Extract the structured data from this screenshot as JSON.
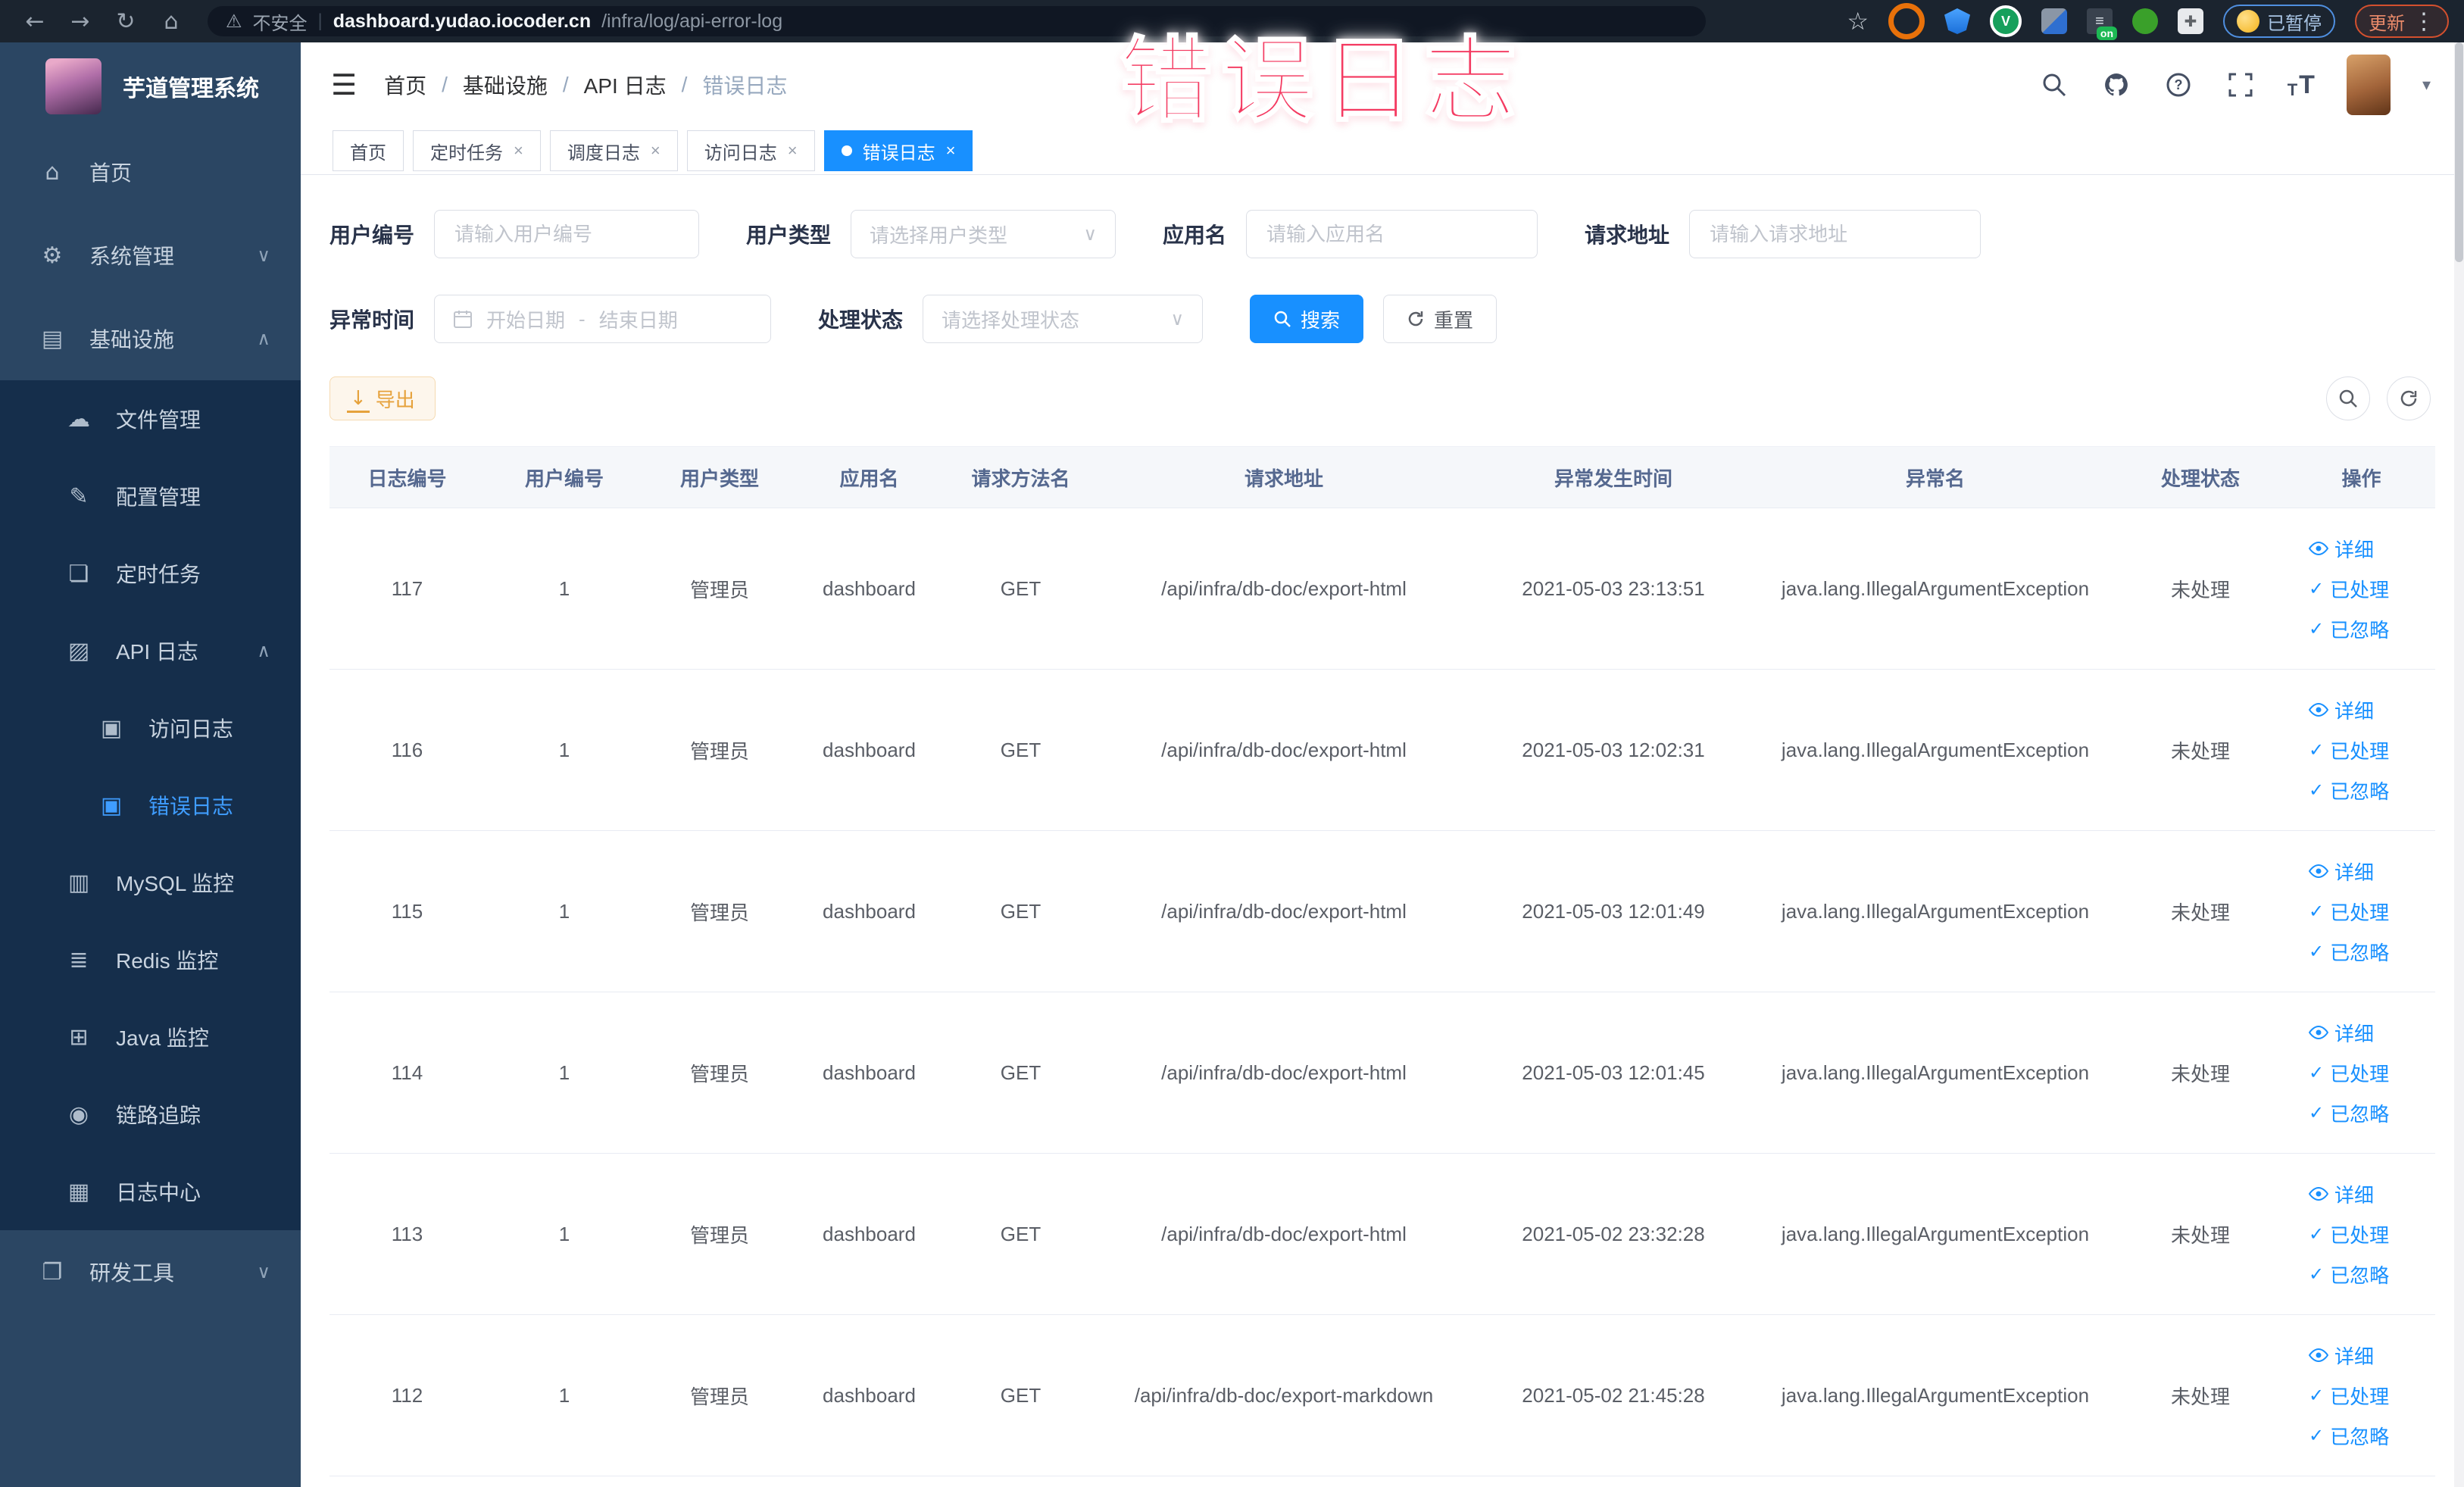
{
  "icons": {
    "back": "←",
    "forward": "→",
    "reload": "↻",
    "home_nav": "⌂",
    "warn": "⚠",
    "url_sep": "|",
    "star": "☆",
    "dots": "⋮",
    "hamburger": "☰",
    "caret": "▾",
    "close": "×",
    "chevron_down": "∨",
    "chevron_up": "∧",
    "home": "⌂",
    "gear": "⚙",
    "infra": "▤",
    "file": "☁",
    "config": "✎",
    "cron": "❏",
    "apilog": "▨",
    "doc": "▣",
    "mysql": "▥",
    "redis": "≣",
    "java": "⊞",
    "trace": "◉",
    "logcenter": "▦",
    "devtools": "❐",
    "check": "✓",
    "download": "↓",
    "breadcrumb_sep": "/",
    "ext_on": "on",
    "ext_v": "V",
    "ext_menu": "≡",
    "ext_puzzle": "✚",
    "help_q": "?"
  },
  "browser": {
    "security_label": "不安全",
    "url_host": "dashboard.yudao.iocoder.cn",
    "url_path": "/infra/log/api-error-log",
    "paused_pill": "已暂停",
    "update_pill": "更新"
  },
  "watermark": "错误日志",
  "sidebar": {
    "app_title": "芋道管理系统",
    "items": [
      {
        "label": "首页"
      },
      {
        "label": "系统管理"
      },
      {
        "label": "基础设施"
      },
      {
        "label": "文件管理"
      },
      {
        "label": "配置管理"
      },
      {
        "label": "定时任务"
      },
      {
        "label": "API 日志"
      },
      {
        "label": "访问日志"
      },
      {
        "label": "错误日志"
      },
      {
        "label": "MySQL 监控"
      },
      {
        "label": "Redis 监控"
      },
      {
        "label": "Java 监控"
      },
      {
        "label": "链路追踪"
      },
      {
        "label": "日志中心"
      },
      {
        "label": "研发工具"
      }
    ]
  },
  "breadcrumb": [
    "首页",
    "基础设施",
    "API 日志",
    "错误日志"
  ],
  "tabs": [
    {
      "label": "首页"
    },
    {
      "label": "定时任务"
    },
    {
      "label": "调度日志"
    },
    {
      "label": "访问日志"
    },
    {
      "label": "错误日志"
    }
  ],
  "form": {
    "user_id": {
      "label": "用户编号",
      "placeholder": "请输入用户编号"
    },
    "user_type": {
      "label": "用户类型",
      "placeholder": "请选择用户类型"
    },
    "app_name": {
      "label": "应用名",
      "placeholder": "请输入应用名"
    },
    "request_url": {
      "label": "请求地址",
      "placeholder": "请输入请求地址"
    },
    "exception_time": {
      "label": "异常时间",
      "start_placeholder": "开始日期",
      "separator": "-",
      "end_placeholder": "结束日期"
    },
    "process_status": {
      "label": "处理状态",
      "placeholder": "请选择处理状态"
    },
    "search_label": "搜索",
    "reset_label": "重置",
    "export_label": "导出"
  },
  "table": {
    "headers": [
      "日志编号",
      "用户编号",
      "用户类型",
      "应用名",
      "请求方法名",
      "请求地址",
      "异常发生时间",
      "异常名",
      "处理状态",
      "操作"
    ],
    "actions": {
      "detail": "详细",
      "processed": "已处理",
      "ignored": "已忽略"
    },
    "rows": [
      {
        "id": "117",
        "user_id": "1",
        "user_type": "管理员",
        "app": "dashboard",
        "method": "GET",
        "url": "/api/infra/db-doc/export-html",
        "time": "2021-05-03 23:13:51",
        "exception": "java.lang.IllegalArgumentException",
        "status": "未处理"
      },
      {
        "id": "116",
        "user_id": "1",
        "user_type": "管理员",
        "app": "dashboard",
        "method": "GET",
        "url": "/api/infra/db-doc/export-html",
        "time": "2021-05-03 12:02:31",
        "exception": "java.lang.IllegalArgumentException",
        "status": "未处理"
      },
      {
        "id": "115",
        "user_id": "1",
        "user_type": "管理员",
        "app": "dashboard",
        "method": "GET",
        "url": "/api/infra/db-doc/export-html",
        "time": "2021-05-03 12:01:49",
        "exception": "java.lang.IllegalArgumentException",
        "status": "未处理"
      },
      {
        "id": "114",
        "user_id": "1",
        "user_type": "管理员",
        "app": "dashboard",
        "method": "GET",
        "url": "/api/infra/db-doc/export-html",
        "time": "2021-05-03 12:01:45",
        "exception": "java.lang.IllegalArgumentException",
        "status": "未处理"
      },
      {
        "id": "113",
        "user_id": "1",
        "user_type": "管理员",
        "app": "dashboard",
        "method": "GET",
        "url": "/api/infra/db-doc/export-html",
        "time": "2021-05-02 23:32:28",
        "exception": "java.lang.IllegalArgumentException",
        "status": "未处理"
      },
      {
        "id": "112",
        "user_id": "1",
        "user_type": "管理员",
        "app": "dashboard",
        "method": "GET",
        "url": "/api/infra/db-doc/export-markdown",
        "time": "2021-05-02 21:45:28",
        "exception": "java.lang.IllegalArgumentException",
        "status": "未处理"
      }
    ]
  },
  "colors": {
    "accent": "#1890ff",
    "watermark": "#f43b62",
    "warning": "#e6a23c",
    "sidebar_bg": "#2b4663",
    "submenu_bg": "#152e4b"
  }
}
